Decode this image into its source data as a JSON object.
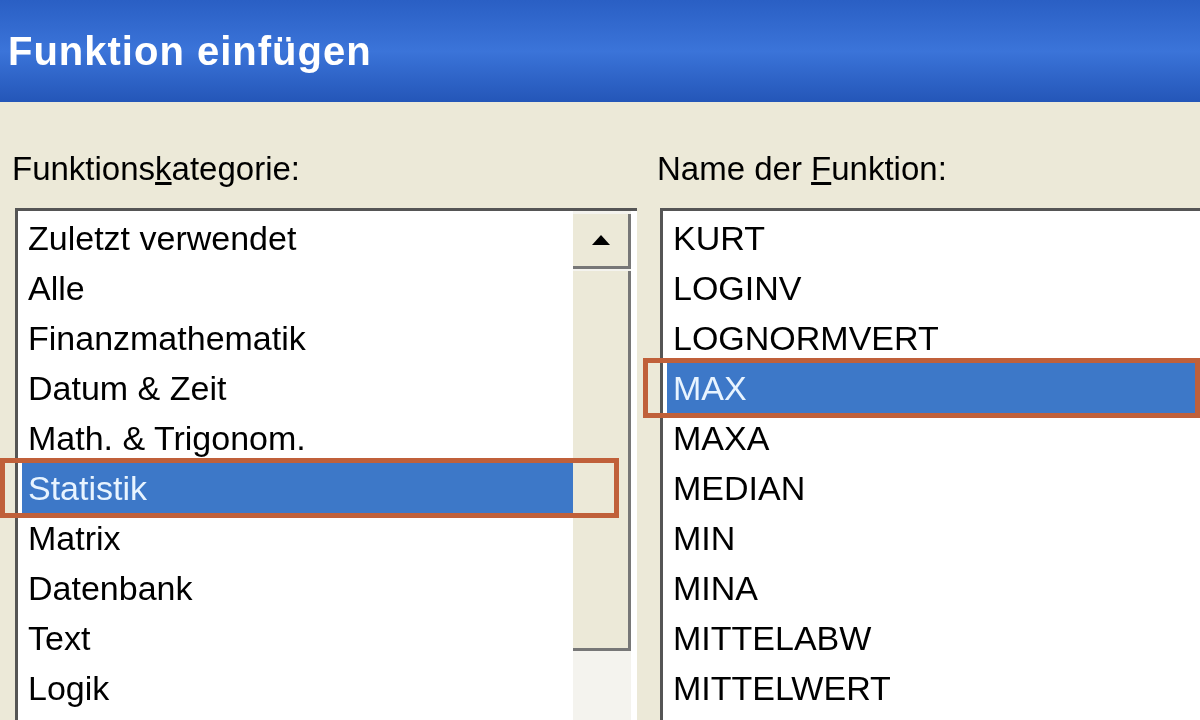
{
  "window": {
    "title": "Funktion einfügen"
  },
  "category_list": {
    "label": {
      "before": "Funktions",
      "key": "k",
      "after": "ategorie:"
    },
    "items": [
      {
        "label": "Zuletzt verwendet",
        "selected": false
      },
      {
        "label": "Alle",
        "selected": false
      },
      {
        "label": "Finanzmathematik",
        "selected": false
      },
      {
        "label": "Datum & Zeit",
        "selected": false
      },
      {
        "label": "Math. & Trigonom.",
        "selected": false
      },
      {
        "label": "Statistik",
        "selected": true
      },
      {
        "label": "Matrix",
        "selected": false
      },
      {
        "label": "Datenbank",
        "selected": false
      },
      {
        "label": "Text",
        "selected": false
      },
      {
        "label": "Logik",
        "selected": false
      }
    ]
  },
  "function_list": {
    "label": {
      "before": "Name der ",
      "key": "F",
      "after": "unktion:"
    },
    "items": [
      {
        "label": "KURT",
        "selected": false
      },
      {
        "label": "LOGINV",
        "selected": false
      },
      {
        "label": "LOGNORMVERT",
        "selected": false
      },
      {
        "label": "MAX",
        "selected": true
      },
      {
        "label": "MAXA",
        "selected": false
      },
      {
        "label": "MEDIAN",
        "selected": false
      },
      {
        "label": "MIN",
        "selected": false
      },
      {
        "label": "MINA",
        "selected": false
      },
      {
        "label": "MITTELABW",
        "selected": false
      },
      {
        "label": "MITTELWERT",
        "selected": false
      }
    ]
  }
}
